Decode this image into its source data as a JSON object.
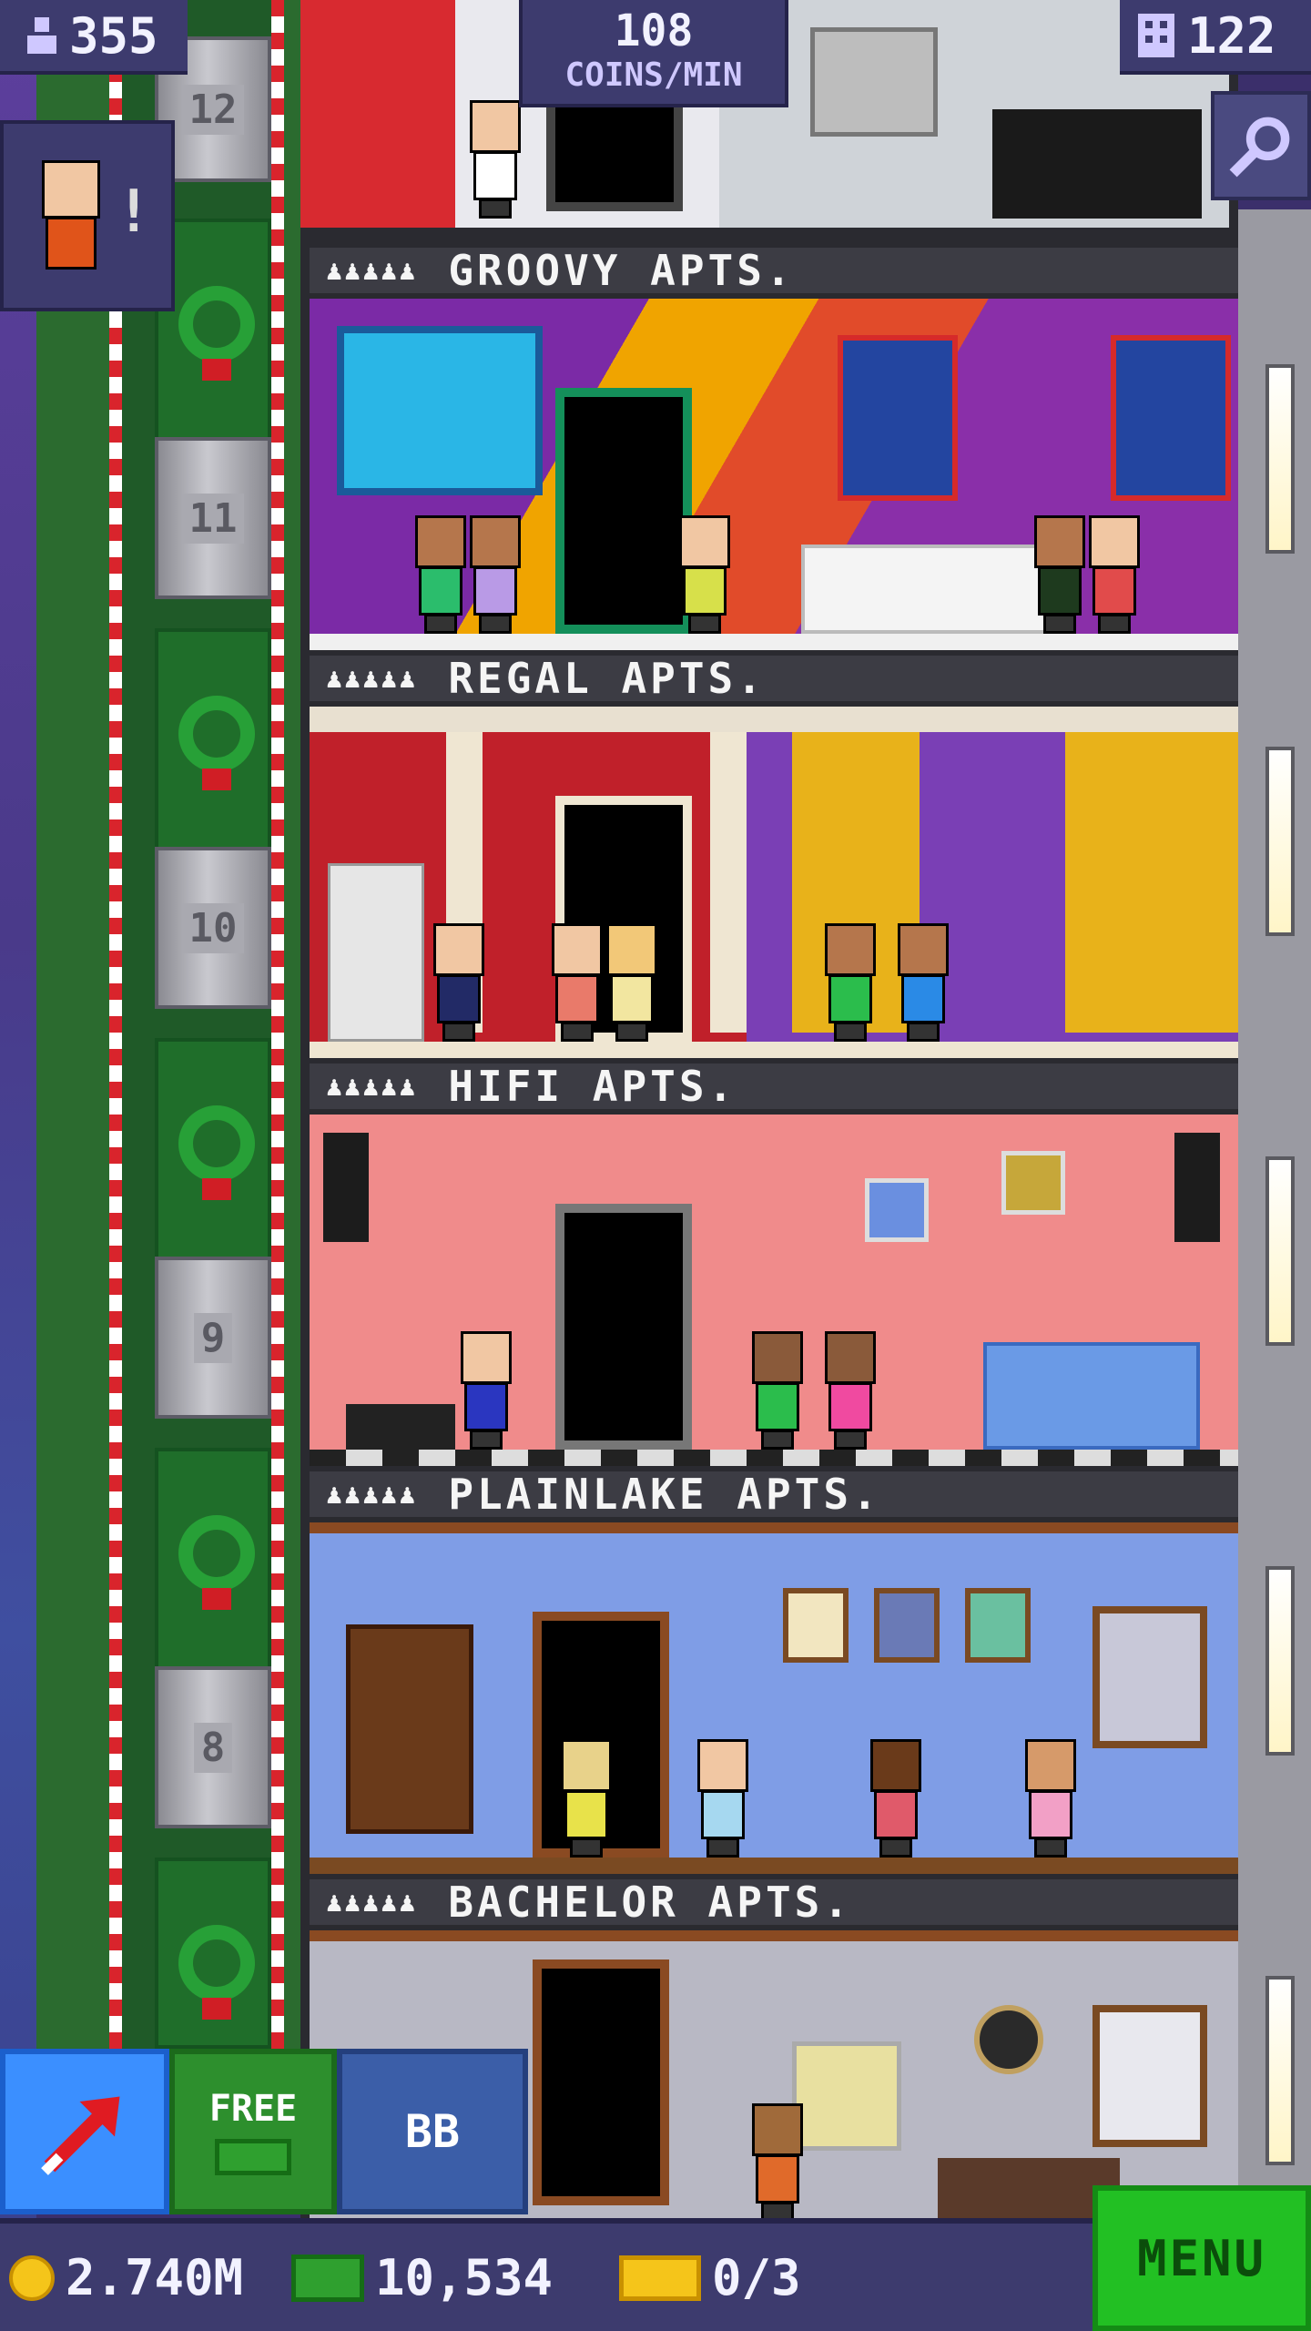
{
  "hud": {
    "population": "355",
    "coins_per_min_value": "108",
    "coins_per_min_label": "COINS/MIN",
    "floors": "122",
    "visitor_alert": "!"
  },
  "elevator": {
    "floor_numbers": [
      "12",
      "11",
      "10",
      "9",
      "8"
    ]
  },
  "floors": [
    {
      "stars": "♟♟♟♟♟",
      "name": "GROOVY APTS."
    },
    {
      "stars": "♟♟♟♟♟",
      "name": "REGAL APTS."
    },
    {
      "stars": "♟♟♟♟♟",
      "name": "HIFI APTS."
    },
    {
      "stars": "♟♟♟♟♟",
      "name": "PLAINLAKE APTS."
    },
    {
      "stars": "♟♟♟♟♟",
      "name": "BACHELOR APTS."
    }
  ],
  "actions": {
    "free_label": "FREE",
    "bb_label": "BB"
  },
  "bottom_bar": {
    "coins": "2.740M",
    "bux": "10,534",
    "tickets": "0/3",
    "menu_label": "MENU"
  },
  "icons": {
    "population": "person-icon",
    "floors": "building-icon",
    "search": "magnifier-icon",
    "elevator": "arrow-up-icon",
    "coins": "coin-icon",
    "bux": "bux-icon",
    "tickets": "ticket-icon"
  },
  "colors": {
    "hud_panel": "#3d3b6e",
    "menu_green": "#22c023",
    "coin_gold": "#f5c51a"
  }
}
